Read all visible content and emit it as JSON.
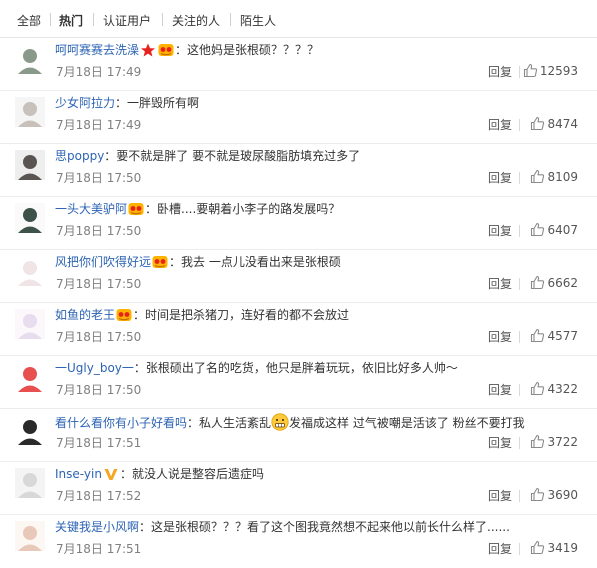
{
  "tabs": [
    {
      "label": "全部"
    },
    {
      "label": "热门",
      "active": true
    },
    {
      "label": "认证用户"
    },
    {
      "label": "关注的人"
    },
    {
      "label": "陌生人"
    }
  ],
  "reply_label": "回复",
  "comments": [
    {
      "name": "呵呵赛赛去洗澡",
      "badges": [
        "star-badge",
        "vip-badge"
      ],
      "text": "：这他妈是张根硕？？？？",
      "time": "7月18日 17:49",
      "likes": "12593",
      "avatar_color": "#8a9a8a"
    },
    {
      "name": "少女阿拉力",
      "badges": [],
      "text": "：一胖毁所有啊",
      "time": "7月18日 17:49",
      "likes": "8474",
      "avatar_color": "#c7c0bb"
    },
    {
      "name": "思poppy",
      "badges": [],
      "text": "：要不就是胖了 要不就是玻尿酸脂肪填充过多了",
      "time": "7月18日 17:50",
      "likes": "8109",
      "avatar_color": "#5a5552"
    },
    {
      "name": "一头大美驴阿",
      "badges": [
        "vip-badge"
      ],
      "text": "：卧槽....要朝着小李子的路发展吗？",
      "time": "7月18日 17:50",
      "likes": "6407",
      "avatar_color": "#3d5248"
    },
    {
      "name": "风把你们吹得好远",
      "badges": [
        "vip-badge"
      ],
      "text": "：我去 一点儿没看出来是张根硕",
      "time": "7月18日 17:50",
      "likes": "6662",
      "avatar_color": "#f0e4e6"
    },
    {
      "name": "如鱼的老王",
      "badges": [
        "vip-badge"
      ],
      "text": "：时间是把杀猪刀，连好看的都不会放过",
      "time": "7月18日 17:50",
      "likes": "4577",
      "avatar_color": "#e8dcef"
    },
    {
      "name": "一Ugly_boy一",
      "badges": [],
      "text": "：张根硕出了名的吃货，他只是胖着玩玩，依旧比好多人帅～",
      "time": "7月18日 17:50",
      "likes": "4322",
      "avatar_color": "#e85050"
    },
    {
      "name": "看什么看你有小子好看吗",
      "badges": [],
      "text_before": "：私人生活紊乱",
      "emoji": "grimace-emoji",
      "text_after": "发福成这样 过气被嘲是活该了 粉丝不要打我",
      "time": "7月18日 17:51",
      "likes": "3722",
      "avatar_color": "#2a2a2a"
    },
    {
      "name": "Inse-yin",
      "badges": [
        "verified-v-badge"
      ],
      "text": "：就没人说是整容后遗症吗",
      "time": "7月18日 17:52",
      "likes": "3690",
      "avatar_color": "#d8d8d8"
    },
    {
      "name": "关键我是小风啊",
      "badges": [],
      "text": "：这是张根硕？？？看了这个图我竟然想不起来他以前长什么样了......",
      "time": "7月18日 17:51",
      "likes": "3419",
      "avatar_color": "#e8c8b8"
    }
  ]
}
